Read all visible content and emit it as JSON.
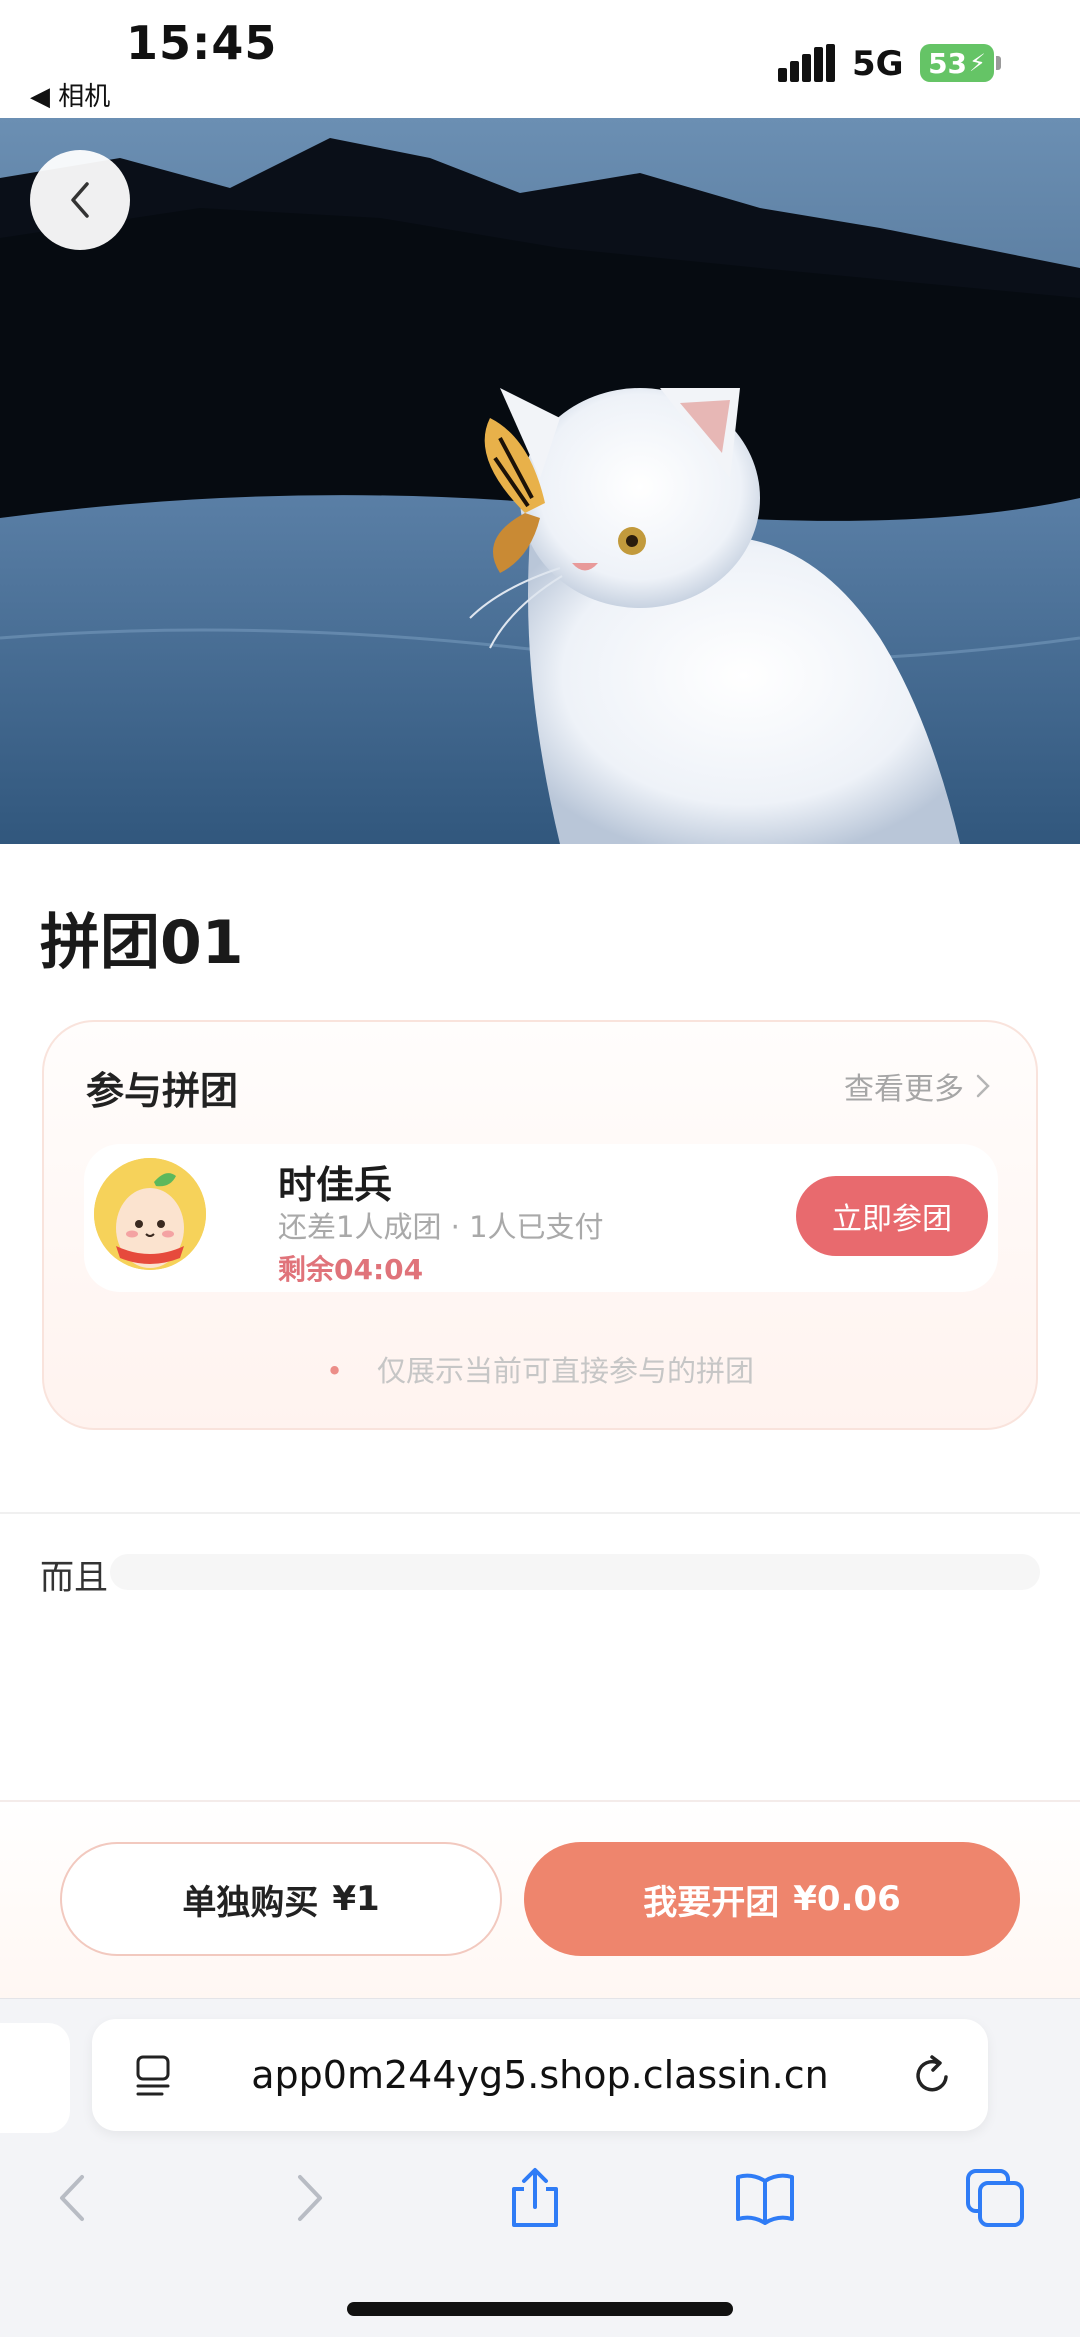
{
  "status_bar": {
    "time": "15:45",
    "back_app": "◀ 相机",
    "network": "5G",
    "battery": "53"
  },
  "hero": {
    "back_icon": "chevron-left-icon"
  },
  "product": {
    "title": "拼团01"
  },
  "group_card": {
    "title": "参与拼团",
    "see_more": "查看更多",
    "member": {
      "name": "时佳兵",
      "status": "还差1人成团 · 1人已支付",
      "timer": "剩余04:04",
      "join_label": "立即参团"
    },
    "note": "仅展示当前可直接参与的拼团"
  },
  "description": {
    "text": "而且"
  },
  "actions": {
    "solo_label": "单独购买",
    "solo_price": "¥1",
    "group_label": "我要开团",
    "group_price": "¥0.06"
  },
  "browser": {
    "url": "app0m244yg5.shop.classin.cn"
  },
  "colors": {
    "primary_button": "#ee856d",
    "join_button": "#e86a6e",
    "timer_text": "#e0737a",
    "battery": "#65c466"
  }
}
